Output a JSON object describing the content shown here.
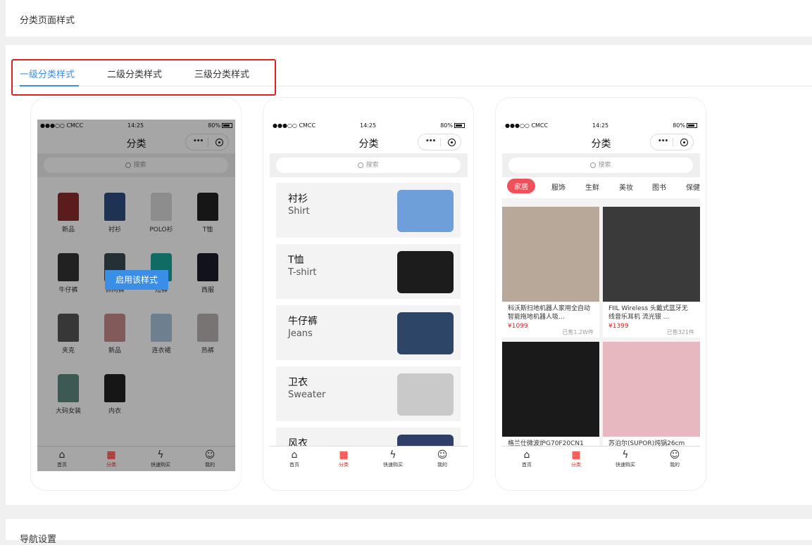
{
  "page": {
    "section_title": "分类页面样式",
    "next_section_title": "导航设置"
  },
  "tabs": [
    {
      "label": "一级分类样式",
      "active": true
    },
    {
      "label": "二级分类样式",
      "active": false
    },
    {
      "label": "三级分类样式",
      "active": false
    }
  ],
  "phone": {
    "carrier": "●●●○○ CMCC",
    "time": "14:25",
    "battery": "80%",
    "nav_title": "分类",
    "capsule_dots": "•••",
    "search_placeholder": "搜索",
    "tabbar": [
      {
        "label": "首页",
        "icon": "home-icon",
        "glyph": "⌂"
      },
      {
        "label": "分类",
        "icon": "grid-icon",
        "glyph": "▦"
      },
      {
        "label": "快速购买",
        "icon": "lightning-icon",
        "glyph": "ϟ"
      },
      {
        "label": "我的",
        "icon": "user-icon",
        "glyph": "☺"
      }
    ]
  },
  "style1": {
    "enable_button": "启用该样式",
    "items": [
      {
        "label": "新品",
        "color": "#8a2b2b"
      },
      {
        "label": "衬衫",
        "color": "#2e4e80"
      },
      {
        "label": "POLO衫",
        "color": "#d9d9d9"
      },
      {
        "label": "T恤",
        "color": "#222222"
      },
      {
        "label": "牛仔裤",
        "color": "#333333"
      },
      {
        "label": "休闲裤",
        "color": "#3a4a50"
      },
      {
        "label": "短裤",
        "color": "#1aa59a"
      },
      {
        "label": "西服",
        "color": "#1c1c2a"
      },
      {
        "label": "夹克",
        "color": "#555555"
      },
      {
        "label": "新品",
        "color": "#c98a8a"
      },
      {
        "label": "连衣裙",
        "color": "#a9c4dc"
      },
      {
        "label": "热裤",
        "color": "#b9b2b2"
      },
      {
        "label": "大码女装",
        "color": "#5d8a80"
      },
      {
        "label": "内衣",
        "color": "#222222"
      }
    ]
  },
  "style2": {
    "cards": [
      {
        "zh": "衬衫",
        "en": "Shirt",
        "color": "#6f9fd8"
      },
      {
        "zh": "T恤",
        "en": "T-shirt",
        "color": "#1c1c1c"
      },
      {
        "zh": "牛仔裤",
        "en": "Jeans",
        "color": "#2d4668"
      },
      {
        "zh": "卫衣",
        "en": "Sweater",
        "color": "#c9c9c9"
      },
      {
        "zh": "风衣",
        "en": "",
        "color": "#2e3e66"
      }
    ]
  },
  "style3": {
    "cat_tabs": [
      "家居",
      "服饰",
      "生鲜",
      "美妆",
      "图书",
      "保健"
    ],
    "products": [
      {
        "name": "科沃斯扫地机器人家用全自动智能拖地机器人吸...",
        "price": "¥1099",
        "sold": "已售1.2W件",
        "color": "#b8a89a"
      },
      {
        "name": "FIIL Wireless 头戴式蓝牙无 线音乐耳机 流光银 ...",
        "price": "¥1399",
        "sold": "已售321件",
        "color": "#3a3a3a"
      },
      {
        "name": "格兰仕微波炉G70F20CN1",
        "price": "",
        "sold": "",
        "color": "#1a1a1a"
      },
      {
        "name": "苏泊尔(SUPOR)炖锅26cm",
        "price": "",
        "sold": "",
        "color": "#e8b8c0"
      }
    ]
  }
}
